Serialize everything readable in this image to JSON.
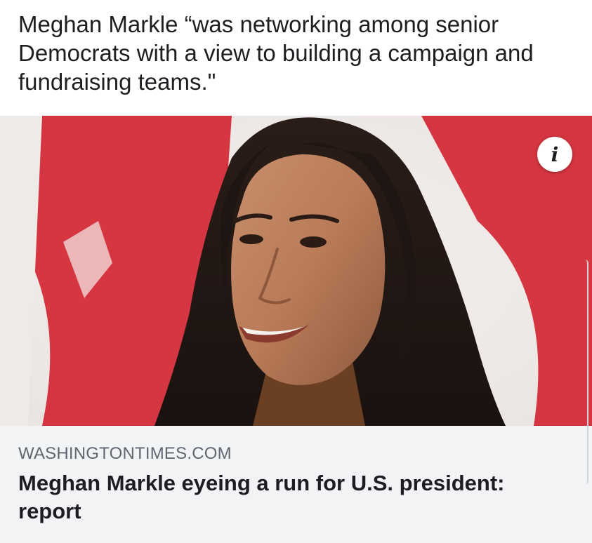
{
  "post": {
    "text": "Meghan Markle “was networking among senior Democrats with a view to building a campaign and fundraising teams.\""
  },
  "link_preview": {
    "domain": "WASHINGTONTIMES.COM",
    "title": "Meghan Markle eyeing a run for U.S. president: report",
    "info_icon_glyph": "i",
    "image_icon": "photo-of-woman-smiling-before-red-flag"
  },
  "colors": {
    "background": "#ffffff",
    "meta_background": "#f2f3f5",
    "domain_text": "#606770",
    "title_text": "#1c1e21",
    "flag_red": "#d32632"
  }
}
